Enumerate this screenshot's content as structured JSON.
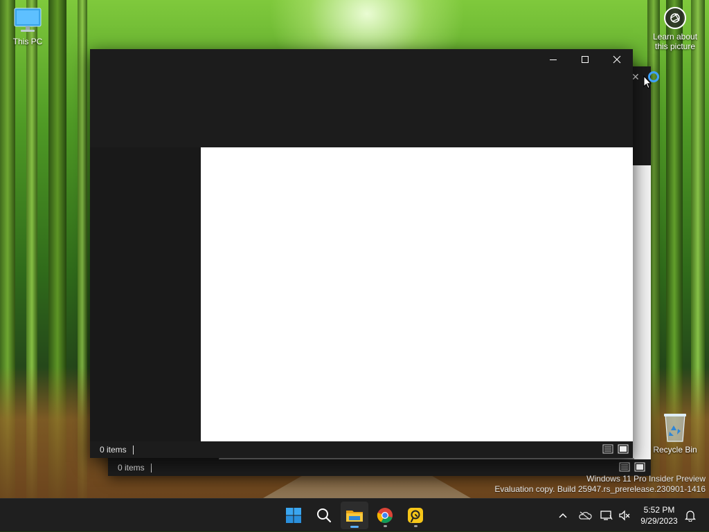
{
  "desktop": {
    "this_pc_label": "This PC",
    "recycle_bin_label": "Recycle Bin",
    "learn_label_line1": "Learn about",
    "learn_label_line2": "this picture"
  },
  "front_window": {
    "status_items": "0 items"
  },
  "back_window": {
    "status_items": "0 items",
    "close_glyph": "✕"
  },
  "watermark": {
    "line1": "Windows 11 Pro Insider Preview",
    "line2": "Evaluation copy. Build 25947.rs_prerelease.230901-1416"
  },
  "taskbar": {
    "time": "5:52 PM",
    "date": "9/29/2023",
    "pinned": [
      "start-icon",
      "search-icon",
      "file-explorer-icon",
      "chrome-icon",
      "remote-desktop-icon"
    ],
    "tray": [
      "chevron-up-icon",
      "onedrive-icon",
      "network-icon",
      "volume-muted-icon",
      "notification-bell-icon"
    ]
  },
  "colors": {
    "window_dark": "#1c1c1c",
    "taskbar": "#1f1f1f",
    "accent_blue": "#3fa3ff"
  }
}
